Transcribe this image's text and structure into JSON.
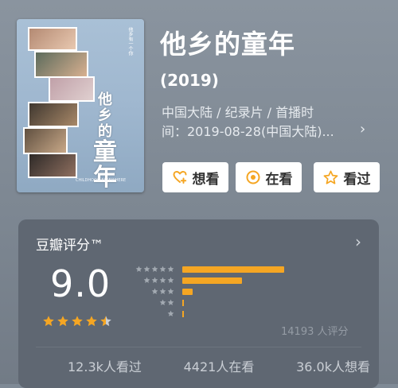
{
  "movie": {
    "title": "他乡的童年",
    "year": "(2019)",
    "meta_line1": "中国大陆 / 纪录片 / 首播时",
    "meta_line2": "间：2019-08-28(中国大陆)..."
  },
  "poster": {
    "big_title_1": "他",
    "big_title_2": "乡",
    "big_title_3": "的",
    "big_title_4": "童",
    "big_title_5": "年",
    "tagline": "他乡有一个你",
    "en_title": "CHILDHOOD ELSEWHERE"
  },
  "actions": {
    "want": "想看",
    "watching": "在看",
    "watched": "看过"
  },
  "rating": {
    "label": "豆瓣评分™",
    "score": "9.0",
    "stars_value": 4.5,
    "count": "14193 人评分",
    "distribution": [
      {
        "stars": 5,
        "fraction": 0.58
      },
      {
        "stars": 4,
        "fraction": 0.34
      },
      {
        "stars": 3,
        "fraction": 0.06
      },
      {
        "stars": 2,
        "fraction": 0.01
      },
      {
        "stars": 1,
        "fraction": 0.0
      }
    ],
    "watched": "12.3k人看过",
    "watching": "4421人在看",
    "want": "36.0k人想看"
  },
  "colors": {
    "accent": "#f5a623",
    "card_bg": "#5f6772"
  }
}
